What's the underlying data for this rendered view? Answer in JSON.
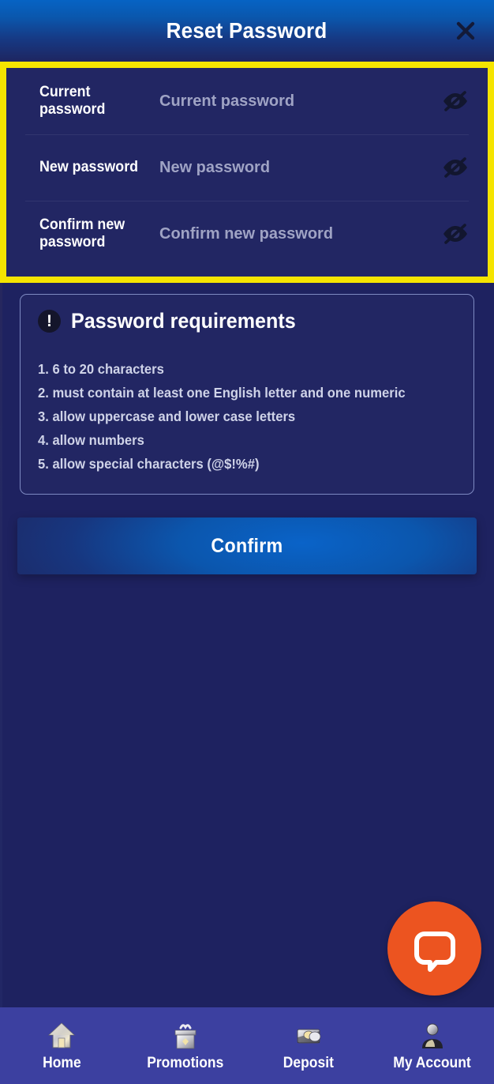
{
  "header": {
    "title": "Reset Password",
    "close_label": "×",
    "gradient_top": "#0663c4",
    "gradient_bottom": "#1e2560"
  },
  "form": {
    "border_color": "#F5E400",
    "background": "#222663",
    "fields": [
      {
        "label": "Current password",
        "placeholder": "Current password",
        "value": "",
        "toggle_icon": "eye-off-icon"
      },
      {
        "label": "New password",
        "placeholder": "New password",
        "value": "",
        "toggle_icon": "eye-off-icon"
      },
      {
        "label": "Confirm new password",
        "placeholder": "Confirm new password",
        "value": "",
        "toggle_icon": "eye-off-icon"
      }
    ]
  },
  "requirements": {
    "icon": "exclamation-circle-icon",
    "icon_glyph": "!",
    "title": "Password requirements",
    "border_color": "#7E8AC2",
    "items": [
      "1. 6 to 20 characters",
      "2. must contain at least one English letter and one numeric",
      "3. allow uppercase and lower case letters",
      "4. allow numbers",
      "5. allow special characters (@$!%#)"
    ]
  },
  "confirm": {
    "label": "Confirm",
    "accent": "#0a63c8"
  },
  "chat": {
    "icon": "chat-bubble-icon",
    "color": "#EC5420"
  },
  "bottom_nav": {
    "background": "#3C40A0",
    "items": [
      {
        "label": "Home",
        "icon": "house-icon"
      },
      {
        "label": "Promotions",
        "icon": "gift-icon"
      },
      {
        "label": "Deposit",
        "icon": "money-icon"
      },
      {
        "label": "My Account",
        "icon": "user-icon"
      }
    ]
  }
}
